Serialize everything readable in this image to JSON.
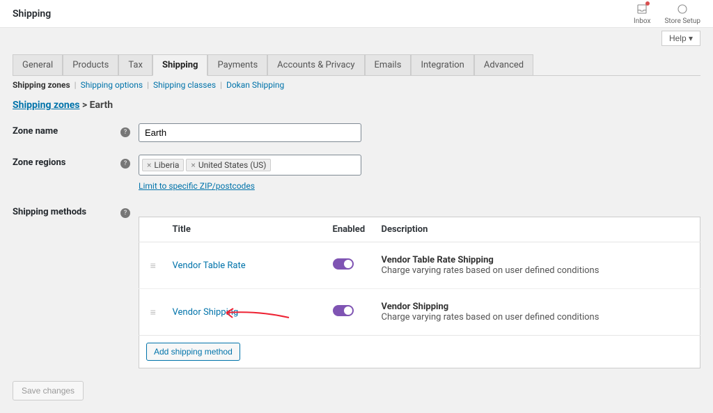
{
  "topbar": {
    "title": "Shipping",
    "inbox_label": "Inbox",
    "setup_label": "Store Setup"
  },
  "help_label": "Help ▾",
  "tabs": [
    {
      "label": "General",
      "active": false
    },
    {
      "label": "Products",
      "active": false
    },
    {
      "label": "Tax",
      "active": false
    },
    {
      "label": "Shipping",
      "active": true
    },
    {
      "label": "Payments",
      "active": false
    },
    {
      "label": "Accounts & Privacy",
      "active": false
    },
    {
      "label": "Emails",
      "active": false
    },
    {
      "label": "Integration",
      "active": false
    },
    {
      "label": "Advanced",
      "active": false
    }
  ],
  "subnav": {
    "current": "Shipping zones",
    "items": [
      "Shipping options",
      "Shipping classes",
      "Dokan Shipping"
    ]
  },
  "breadcrumb": {
    "root": "Shipping zones",
    "sep": " > ",
    "leaf": "Earth"
  },
  "form": {
    "zone_name": {
      "label": "Zone name",
      "value": "Earth"
    },
    "zone_regions": {
      "label": "Zone regions",
      "chips": [
        "Liberia",
        "United States (US)"
      ],
      "limit_link": "Limit to specific ZIP/postcodes"
    },
    "shipping_methods": {
      "label": "Shipping methods",
      "headers": {
        "title": "Title",
        "enabled": "Enabled",
        "description": "Description"
      },
      "rows": [
        {
          "title": "Vendor Table Rate",
          "desc_title": "Vendor Table Rate Shipping",
          "desc_text": "Charge varying rates based on user defined conditions"
        },
        {
          "title": "Vendor Shipping",
          "desc_title": "Vendor Shipping",
          "desc_text": "Charge varying rates based on user defined conditions"
        }
      ],
      "add_button": "Add shipping method"
    }
  },
  "save_button": "Save changes"
}
